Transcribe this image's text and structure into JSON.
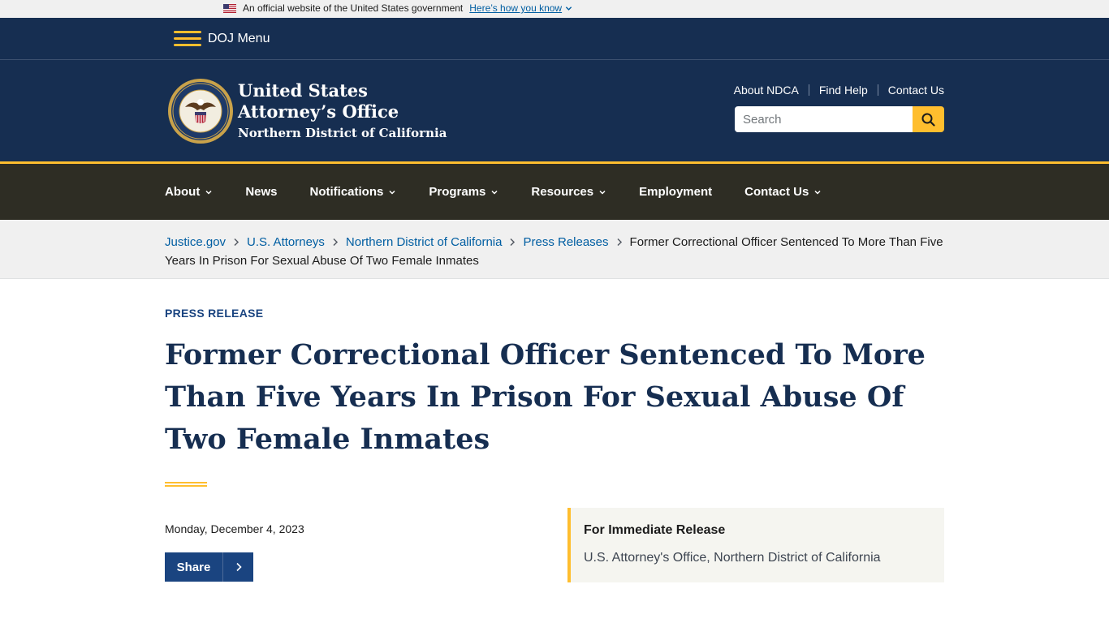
{
  "gov_banner": {
    "text": "An official website of the United States government",
    "link": "Here’s how you know"
  },
  "doj_bar": {
    "menu_label": "DOJ Menu"
  },
  "header": {
    "title_line1": "United States",
    "title_line2": "Attorney’s Office",
    "title_line3": "Northern District of California",
    "utility_links": [
      "About NDCA",
      "Find Help",
      "Contact Us"
    ],
    "search_placeholder": "Search"
  },
  "nav": {
    "items": [
      {
        "label": "About",
        "dropdown": true
      },
      {
        "label": "News",
        "dropdown": false
      },
      {
        "label": "Notifications",
        "dropdown": true
      },
      {
        "label": "Programs",
        "dropdown": true
      },
      {
        "label": "Resources",
        "dropdown": true
      },
      {
        "label": "Employment",
        "dropdown": false
      },
      {
        "label": "Contact Us",
        "dropdown": true
      }
    ]
  },
  "breadcrumb": {
    "items": [
      "Justice.gov",
      "U.S. Attorneys",
      "Northern District of California",
      "Press Releases"
    ],
    "current": "Former Correctional Officer Sentenced To More Than Five Years In Prison For Sexual Abuse Of Two Female Inmates"
  },
  "article": {
    "eyebrow": "PRESS RELEASE",
    "title": "Former Correctional Officer Sentenced To More Than Five Years In Prison For Sexual Abuse Of Two Female Inmates",
    "date": "Monday, December 4, 2023",
    "share_label": "Share"
  },
  "release_box": {
    "title": "For Immediate Release",
    "source": "U.S. Attorney's Office, Northern District of California"
  },
  "colors": {
    "navy": "#162e51",
    "gold": "#ffbe2e",
    "nav_dark": "#2e2d24",
    "link_blue": "#005ea2",
    "button_blue": "#1a4480"
  }
}
